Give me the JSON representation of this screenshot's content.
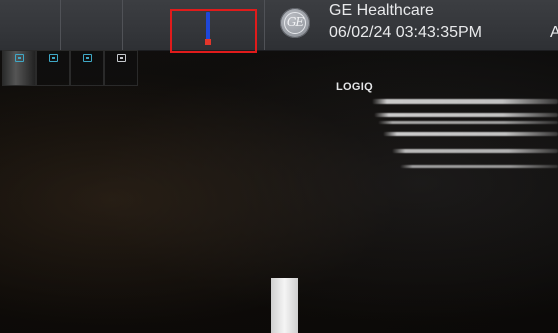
{
  "status_bar": {
    "company": "GE Healthcare",
    "datetime": "06/02/24 03:43:35PM",
    "edge_letter": "A"
  },
  "logo": {
    "icon": "ge-monogram-icon",
    "monogram": "GE"
  },
  "probe_indicator": {
    "icon": "probe-position-icon",
    "bar_color": "#1f47d9",
    "marker_color": "#e3362b",
    "highlight_color": "#e11b1b"
  },
  "thumbnails": [
    {
      "icon": "image-thumbnail-icon",
      "icon_color": "#3fa8c6"
    },
    {
      "icon": "image-thumbnail-icon",
      "icon_color": "#3fa8c6"
    },
    {
      "icon": "image-thumbnail-icon",
      "icon_color": "#3fa8c6"
    },
    {
      "icon": "image-thumbnail-icon",
      "icon_color": "#c6c9cd"
    }
  ],
  "brand": "LOGIQ"
}
